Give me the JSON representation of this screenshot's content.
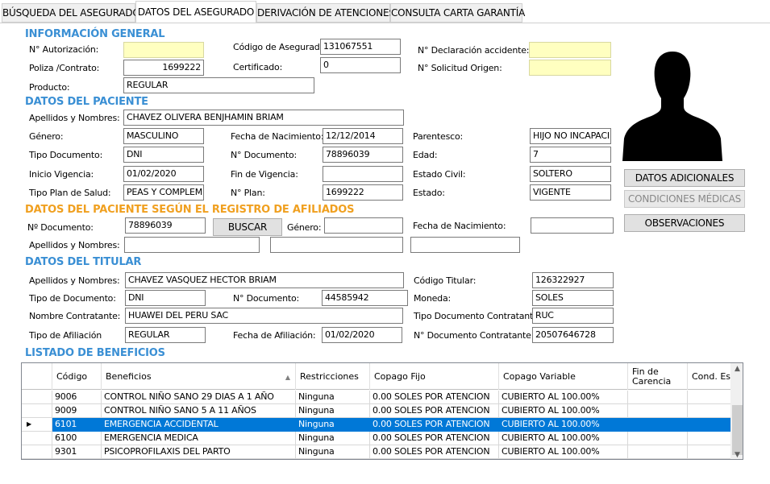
{
  "tabs": [
    "BÚSQUEDA DEL ASEGURADO",
    "DATOS DEL ASEGURADO",
    "DERIVACIÓN DE ATENCIONES",
    "CONSULTA CARTA GARANTÍA"
  ],
  "general": {
    "title": "INFORMACIÓN GENERAL",
    "autorizacion_label": "N° Autorización:",
    "autorizacion_value": "",
    "poliza_label": "Poliza /Contrato:",
    "poliza_value": "1699222",
    "producto_label": "Producto:",
    "producto_value": "REGULAR",
    "codigo_label": "Código de Asegurado:",
    "codigo_value": "131067551",
    "certificado_label": "Certificado:",
    "certificado_value": "0",
    "declaracion_label": "N° Declaración accidente:",
    "declaracion_value": "",
    "solicitud_label": "N° Solicitud Origen:",
    "solicitud_value": ""
  },
  "paciente": {
    "title": "DATOS DEL PACIENTE",
    "nombres_label": "Apellidos y Nombres:",
    "nombres_value": "CHAVEZ OLIVERA BENJHAMIN BRIAM",
    "genero_label": "Género:",
    "genero_value": "MASCULINO",
    "tipodoc_label": "Tipo Documento:",
    "tipodoc_value": "DNI",
    "inicio_label": "Inicio Vigencia:",
    "inicio_value": "01/02/2020",
    "plan_label": "Tipo Plan de Salud:",
    "plan_value": "PEAS Y COMPLEM",
    "fnac_label": "Fecha de Nacimiento:",
    "fnac_value": "12/12/2014",
    "ndoc_label": "N° Documento:",
    "ndoc_value": "78896039",
    "fin_label": "Fin de Vigencia:",
    "fin_value": "",
    "nplan_label": "N° Plan:",
    "nplan_value": "1699222",
    "parentesco_label": "Parentesco:",
    "parentesco_value": "HIJO NO INCAPACI",
    "edad_label": "Edad:",
    "edad_value": "7",
    "civil_label": "Estado Civil:",
    "civil_value": "SOLTERO",
    "estado_label": "Estado:",
    "estado_value": "VIGENTE"
  },
  "afiliados": {
    "title": "DATOS DEL PACIENTE SEGÚN EL REGISTRO DE AFILIADOS",
    "ndoc_label": "Nº Documento:",
    "ndoc_value": "78896039",
    "buscar": "BUSCAR",
    "genero_label": "Género:",
    "genero_value": "",
    "fnac_label": "Fecha de Nacimiento:",
    "fnac_value": "",
    "nombres_label": "Apellidos y Nombres:",
    "ap1": "",
    "ap2": "",
    "nombre": ""
  },
  "titular": {
    "title": "DATOS DEL TITULAR",
    "nombres_label": "Apellidos y Nombres:",
    "nombres_value": "CHAVEZ VASQUEZ HECTOR BRIAM",
    "tipodoc_label": "Tipo de Documento:",
    "tipodoc_value": "DNI",
    "contratante_label": "Nombre Contratante:",
    "contratante_value": "HUAWEI DEL PERU SAC",
    "afiliacion_label": "Tipo de Afiliación",
    "afiliacion_value": "REGULAR",
    "ndoc_label": "N° Documento:",
    "ndoc_value": "44585942",
    "fafil_label": "Fecha de Afiliación:",
    "fafil_value": "01/02/2020",
    "codtit_label": "Código Titular:",
    "codtit_value": "126322927",
    "moneda_label": "Moneda:",
    "moneda_value": "SOLES",
    "tdc_label": "Tipo Documento Contratante:",
    "tdc_value": "RUC",
    "ndc_label": "N° Documento Contratante:",
    "ndc_value": "20507646728"
  },
  "buttons": {
    "adicionales": "DATOS ADICIONALES",
    "condiciones": "CONDICIONES MÉDICAS",
    "observaciones": "OBSERVACIONES"
  },
  "beneficios": {
    "title": "LISTADO DE BENEFICIOS",
    "headers": [
      "Código",
      "Beneficios",
      "Restricciones",
      "Copago Fijo",
      "Copago Variable",
      "Fin de Carencia",
      "Cond. Esp"
    ],
    "rows": [
      [
        "9006",
        "CONTROL NIÑO SANO 29 DIAS A 1 AÑO",
        "Ninguna",
        "0.00 SOLES POR ATENCION",
        "CUBIERTO AL 100.00%",
        "",
        ""
      ],
      [
        "9009",
        "CONTROL NIÑO SANO 5 A 11 AÑOS",
        "Ninguna",
        "0.00 SOLES POR ATENCION",
        "CUBIERTO AL 100.00%",
        "",
        ""
      ],
      [
        "6101",
        "EMERGENCIA ACCIDENTAL",
        "Ninguna",
        "0.00 SOLES POR ATENCION",
        "CUBIERTO AL 100.00%",
        "",
        ""
      ],
      [
        "6100",
        "EMERGENCIA MEDICA",
        "Ninguna",
        "0.00 SOLES POR ATENCION",
        "CUBIERTO AL 100.00%",
        "",
        ""
      ],
      [
        "9301",
        "PSICOPROFILAXIS DEL PARTO",
        "Ninguna",
        "0.00 SOLES POR ATENCION",
        "CUBIERTO AL 100.00%",
        "",
        ""
      ]
    ],
    "selected_row": 2
  },
  "icons": {
    "row_selector": "triangle-right-icon",
    "scroll_up": "chevron-up-icon",
    "scroll_down": "chevron-down-icon",
    "sort": "sort-ascending-icon",
    "photo": "person-silhouette-icon"
  },
  "colors": {
    "section_blue": "#3a8fd4",
    "section_orange": "#f0a020",
    "selection": "#0078d7",
    "yellow_field": "#ffffc0"
  }
}
